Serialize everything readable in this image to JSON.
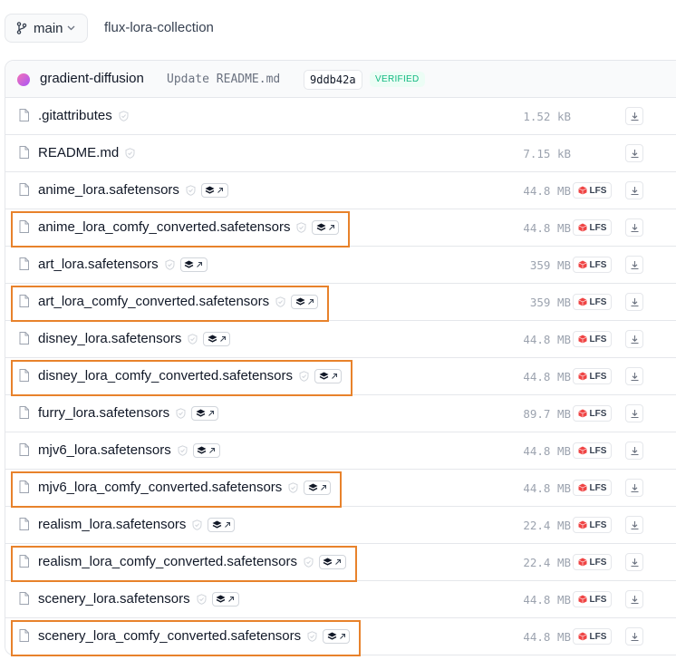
{
  "header": {
    "branch": "main",
    "repo": "flux-lora-collection"
  },
  "commit": {
    "author": "gradient-diffusion",
    "message": "Update README.md",
    "hash": "9ddb42a",
    "verified": "VERIFIED"
  },
  "lfs_label": "LFS",
  "colors": {
    "highlight": "#e8822b",
    "lfs_red": "#ef4444",
    "verified_green": "#10b981"
  },
  "files": [
    {
      "name": ".gitattributes",
      "size": "1.52 kB",
      "lfs": false,
      "pickle": false,
      "highlighted": false
    },
    {
      "name": "README.md",
      "size": "7.15 kB",
      "lfs": false,
      "pickle": false,
      "highlighted": false
    },
    {
      "name": "anime_lora.safetensors",
      "size": "44.8 MB",
      "lfs": true,
      "pickle": true,
      "highlighted": false
    },
    {
      "name": "anime_lora_comfy_converted.safetensors",
      "size": "44.8 MB",
      "lfs": true,
      "pickle": true,
      "highlighted": true
    },
    {
      "name": "art_lora.safetensors",
      "size": "359 MB",
      "lfs": true,
      "pickle": true,
      "highlighted": false
    },
    {
      "name": "art_lora_comfy_converted.safetensors",
      "size": "359 MB",
      "lfs": true,
      "pickle": true,
      "highlighted": true
    },
    {
      "name": "disney_lora.safetensors",
      "size": "44.8 MB",
      "lfs": true,
      "pickle": true,
      "highlighted": false
    },
    {
      "name": "disney_lora_comfy_converted.safetensors",
      "size": "44.8 MB",
      "lfs": true,
      "pickle": true,
      "highlighted": true
    },
    {
      "name": "furry_lora.safetensors",
      "size": "89.7 MB",
      "lfs": true,
      "pickle": true,
      "highlighted": false
    },
    {
      "name": "mjv6_lora.safetensors",
      "size": "44.8 MB",
      "lfs": true,
      "pickle": true,
      "highlighted": false
    },
    {
      "name": "mjv6_lora_comfy_converted.safetensors",
      "size": "44.8 MB",
      "lfs": true,
      "pickle": true,
      "highlighted": true
    },
    {
      "name": "realism_lora.safetensors",
      "size": "22.4 MB",
      "lfs": true,
      "pickle": true,
      "highlighted": false
    },
    {
      "name": "realism_lora_comfy_converted.safetensors",
      "size": "22.4 MB",
      "lfs": true,
      "pickle": true,
      "highlighted": true
    },
    {
      "name": "scenery_lora.safetensors",
      "size": "44.8 MB",
      "lfs": true,
      "pickle": true,
      "highlighted": false
    },
    {
      "name": "scenery_lora_comfy_converted.safetensors",
      "size": "44.8 MB",
      "lfs": true,
      "pickle": true,
      "highlighted": true
    }
  ]
}
